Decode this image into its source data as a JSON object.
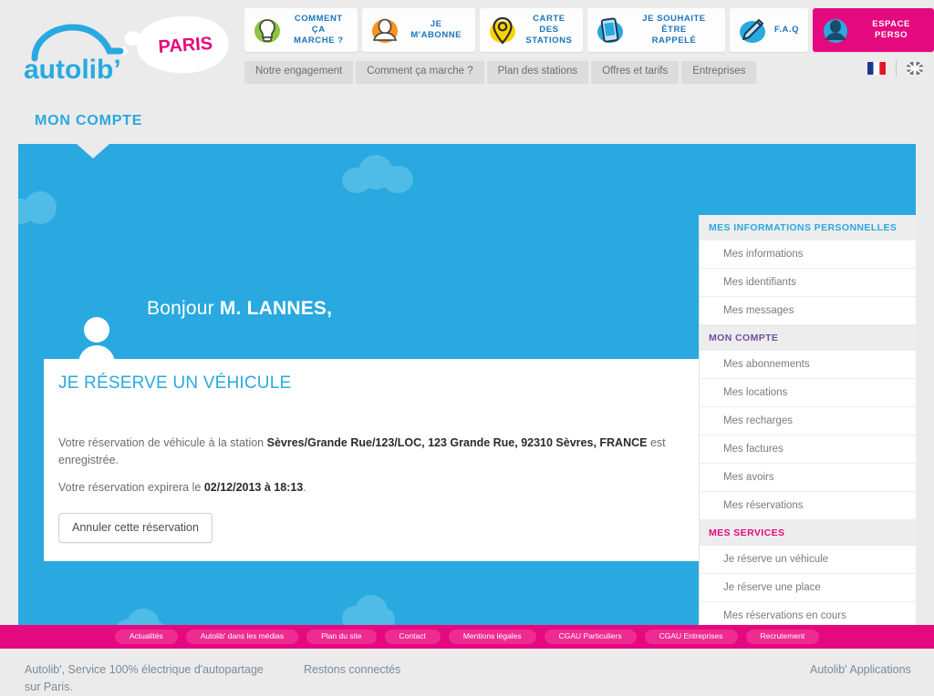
{
  "brand": {
    "name": "autolib'",
    "city": "PARIS"
  },
  "topnav": [
    {
      "label": "COMMENT ÇA\nMARCHE ?",
      "icon": "lightbulb-icon",
      "accent": false
    },
    {
      "label": "JE M'ABONNE",
      "icon": "person-orange-icon",
      "accent": false
    },
    {
      "label": "CARTE DES\nSTATIONS",
      "icon": "map-pin-icon",
      "accent": false
    },
    {
      "label": "JE SOUHAITE ÊTRE\nRAPPELÉ",
      "icon": "smartphone-icon",
      "accent": false
    },
    {
      "label": "F.A.Q",
      "icon": "pencil-icon",
      "accent": false
    },
    {
      "label": "ESPACE PERSO",
      "icon": "person-blue-icon",
      "accent": true
    }
  ],
  "subnav": [
    "Notre engagement",
    "Comment ça marche ?",
    "Plan des stations",
    "Offres et tarifs",
    "Entreprises"
  ],
  "languages": [
    {
      "name": "french-flag-icon",
      "code": "fr"
    },
    {
      "name": "uk-flag-icon",
      "code": "en"
    }
  ],
  "page": {
    "title": "MON COMPTE"
  },
  "greeting": {
    "hello": "Bonjour ",
    "user": "M. LANNES,"
  },
  "card": {
    "title": "JE RÉSERVE UN VÉHICULE",
    "paragraph1_pre": "Votre réservation de véhicule à la station ",
    "paragraph1_bold": "Sèvres/Grande Rue/123/LOC, 123 Grande Rue, 92310 Sèvres, FRANCE",
    "paragraph1_post": " est enregistrée.",
    "paragraph2_pre": "Votre réservation expirera le ",
    "paragraph2_bold": "02/12/2013 à 18:13",
    "paragraph2_post": ".",
    "cancel_label": "Annuler cette réservation"
  },
  "sidebar": {
    "groups": [
      {
        "title": "MES INFORMATIONS PERSONNELLES",
        "color": "c-blue",
        "items": [
          "Mes informations",
          "Mes identifiants",
          "Mes messages"
        ]
      },
      {
        "title": "MON COMPTE",
        "color": "c-purple",
        "items": [
          "Mes abonnements",
          "Mes locations",
          "Mes recharges",
          "Mes factures",
          "Mes avoirs",
          "Mes réservations"
        ]
      },
      {
        "title": "MES SERVICES",
        "color": "c-pink",
        "items": [
          "Je réserve un véhicule",
          "Je réserve une place",
          "Mes réservations en cours"
        ]
      }
    ]
  },
  "footer": {
    "links": [
      "Actualités",
      "Autolib' dans les médias",
      "Plan du site",
      "Contact",
      "Mentions légales",
      "CGAU Particuliers",
      "CGAU Entreprises",
      "Recrutement"
    ],
    "col1": "Autolib', Service 100% électrique d'autopartage sur Paris.",
    "col2": "Restons connectés",
    "col3": "Autolib' Applications"
  },
  "colors": {
    "blue": "#29a9e0",
    "pink": "#e5097f",
    "purple": "#6f4fa0",
    "page_bg": "#ebebeb",
    "cloud": "#4fbce8"
  }
}
